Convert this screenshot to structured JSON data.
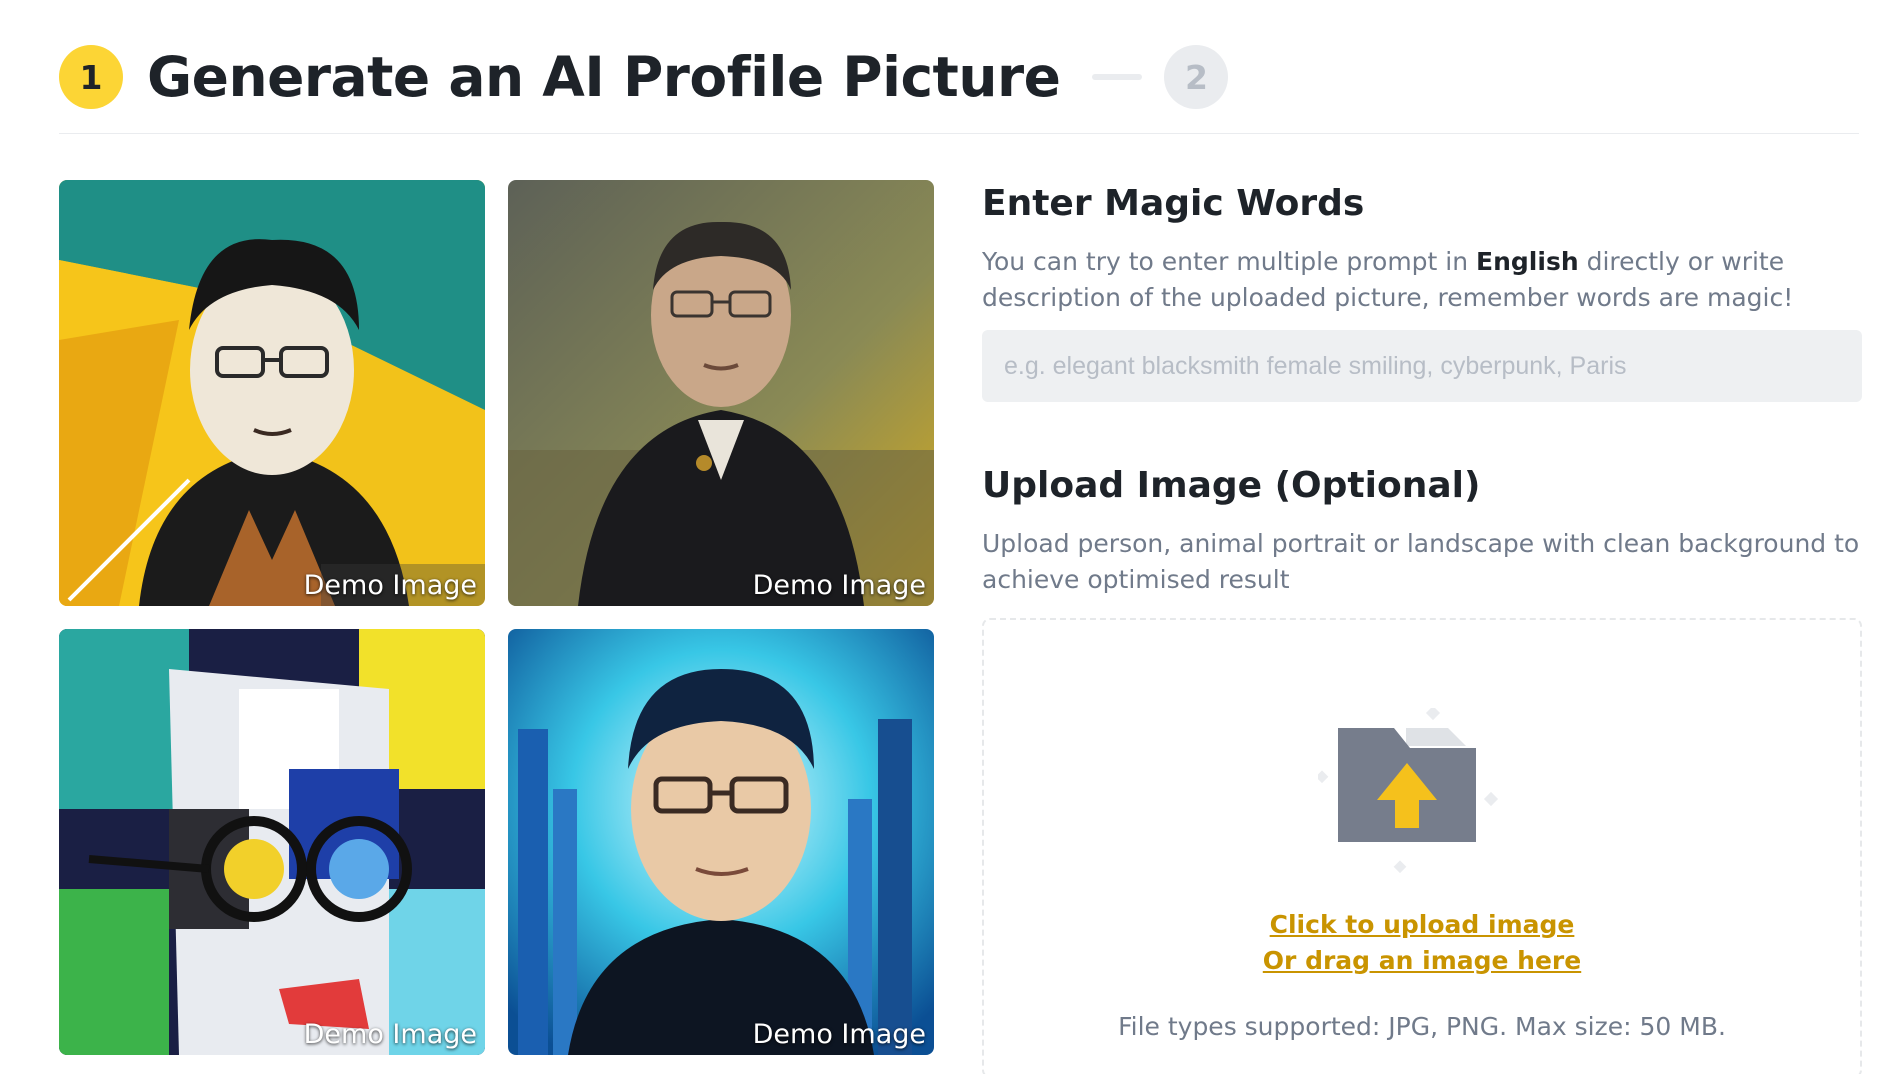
{
  "stepper": {
    "step1_number": "1",
    "step1_title": "Generate an AI Profile Picture",
    "step2_number": "2"
  },
  "gallery": {
    "items": [
      {
        "label": "Demo Image"
      },
      {
        "label": "Demo Image"
      },
      {
        "label": "Demo Image"
      },
      {
        "label": "Demo Image"
      }
    ]
  },
  "magic_words": {
    "title": "Enter Magic Words",
    "desc_before": "You can try to enter multiple prompt in ",
    "desc_bold": "English",
    "desc_after": " directly or write description of the uploaded picture, remember words are magic!",
    "input_value": "",
    "placeholder": "e.g. elegant blacksmith female smiling, cyberpunk, Paris"
  },
  "upload": {
    "title": "Upload Image (Optional)",
    "desc": "Upload person, animal portrait or landscape with clean background to achieve optimised result",
    "click_label": "Click to upload image",
    "drag_label": "Or drag an image here",
    "hint": "File types supported: JPG, PNG. Max size: 50 MB."
  },
  "colors": {
    "accent": "#fcd535",
    "link": "#c99400",
    "text_primary": "#1e2329",
    "text_secondary": "#707a8a"
  },
  "icons": [
    "folder-upload-icon",
    "up-arrow-icon"
  ]
}
